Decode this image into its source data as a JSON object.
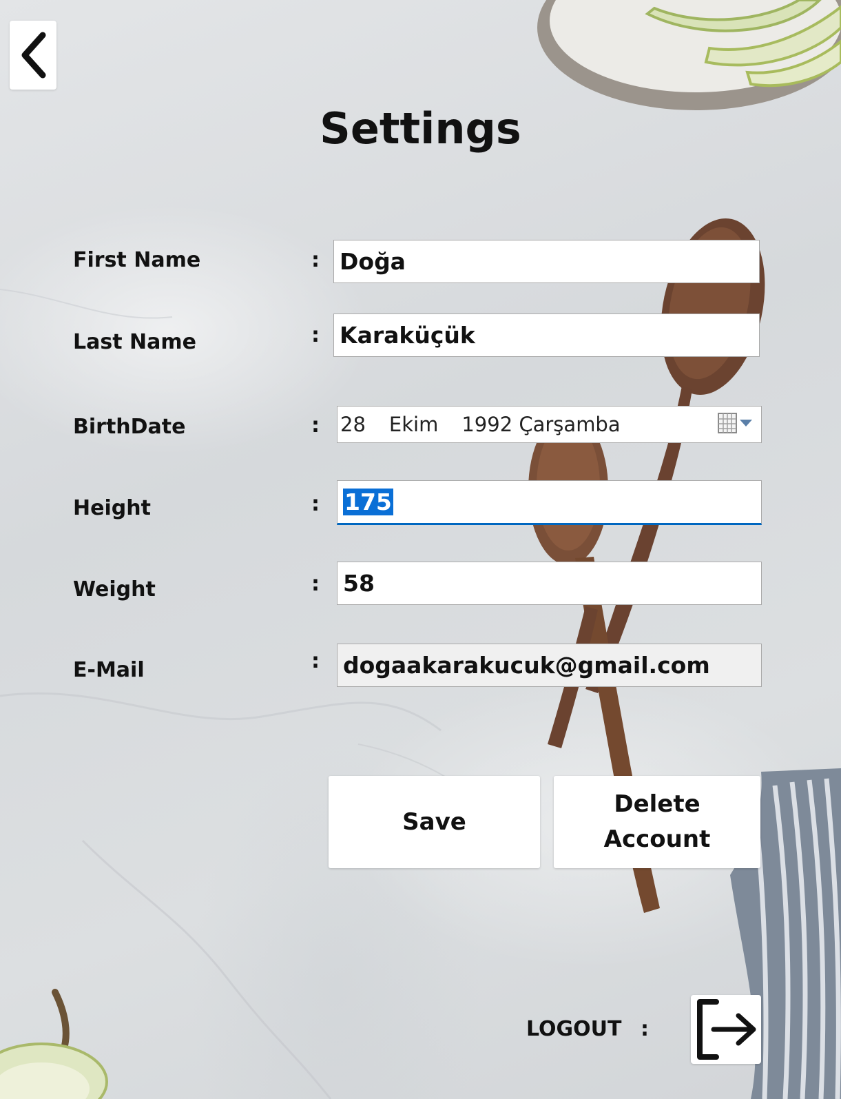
{
  "header": {
    "title": "Settings"
  },
  "form": {
    "first_name": {
      "label": "First Name",
      "colon": ":",
      "value": "Doğa"
    },
    "last_name": {
      "label": "Last Name",
      "colon": ":",
      "value": "Karaküçük"
    },
    "birth_date": {
      "label": "BirthDate",
      "colon": ":",
      "day": "28",
      "month": "Ekim",
      "year_weekday": "1992 Çarşamba"
    },
    "height": {
      "label": "Height",
      "colon": ":",
      "value": "175"
    },
    "weight": {
      "label": "Weight",
      "colon": ":",
      "value": "58"
    },
    "email": {
      "label": "E-Mail",
      "colon": ":",
      "value": "dogaakarakucuk@gmail.com"
    }
  },
  "actions": {
    "save_label": "Save",
    "delete_line1": "Delete",
    "delete_line2": "Account"
  },
  "footer": {
    "logout_label": "LOGOUT",
    "logout_colon": ":"
  },
  "icons": {
    "back": "chevron-left-icon",
    "calendar": "calendar-icon",
    "dropdown": "chevron-down-icon",
    "logout": "logout-icon"
  },
  "colors": {
    "selection": "#0a6fd6",
    "focus_underline": "#0067c0",
    "text": "#111111"
  }
}
